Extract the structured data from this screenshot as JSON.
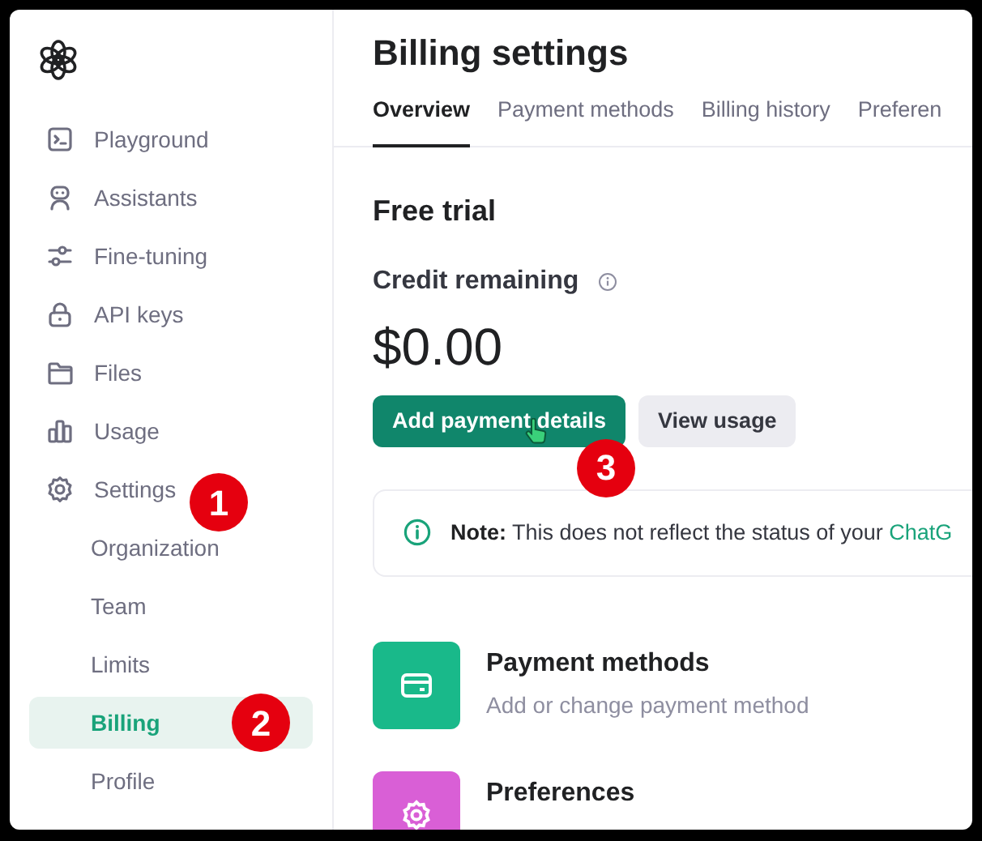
{
  "sidebar": {
    "items": [
      {
        "label": "Playground",
        "selected": false
      },
      {
        "label": "Assistants",
        "selected": false
      },
      {
        "label": "Fine-tuning",
        "selected": false
      },
      {
        "label": "API keys",
        "selected": false
      },
      {
        "label": "Files",
        "selected": false
      },
      {
        "label": "Usage",
        "selected": false
      },
      {
        "label": "Settings",
        "selected": false,
        "step": "1",
        "children": [
          {
            "label": "Organization",
            "selected": false
          },
          {
            "label": "Team",
            "selected": false
          },
          {
            "label": "Limits",
            "selected": false
          },
          {
            "label": "Billing",
            "selected": true,
            "step": "2"
          },
          {
            "label": "Profile",
            "selected": false
          }
        ]
      }
    ]
  },
  "page": {
    "title": "Billing settings",
    "tabs": [
      {
        "label": "Overview",
        "selected": true
      },
      {
        "label": "Payment methods",
        "selected": false
      },
      {
        "label": "Billing history",
        "selected": false
      },
      {
        "label": "Preferen",
        "selected": false
      }
    ],
    "section_title": "Free trial",
    "credit_label": "Credit remaining",
    "credit_amount": "$0.00",
    "buttons": [
      {
        "label": "Add payment details",
        "kind": "primary",
        "step": "3"
      },
      {
        "label": "View usage",
        "kind": "secondary"
      }
    ],
    "note": {
      "text": "**Note:** This does not reflect the status of your ",
      "link": "ChatG"
    },
    "cards": [
      {
        "title": "Payment methods",
        "description": "Add or change payment method",
        "color": "#19b98a"
      },
      {
        "title": "Preferences",
        "color": "#d95fd6"
      }
    ]
  }
}
